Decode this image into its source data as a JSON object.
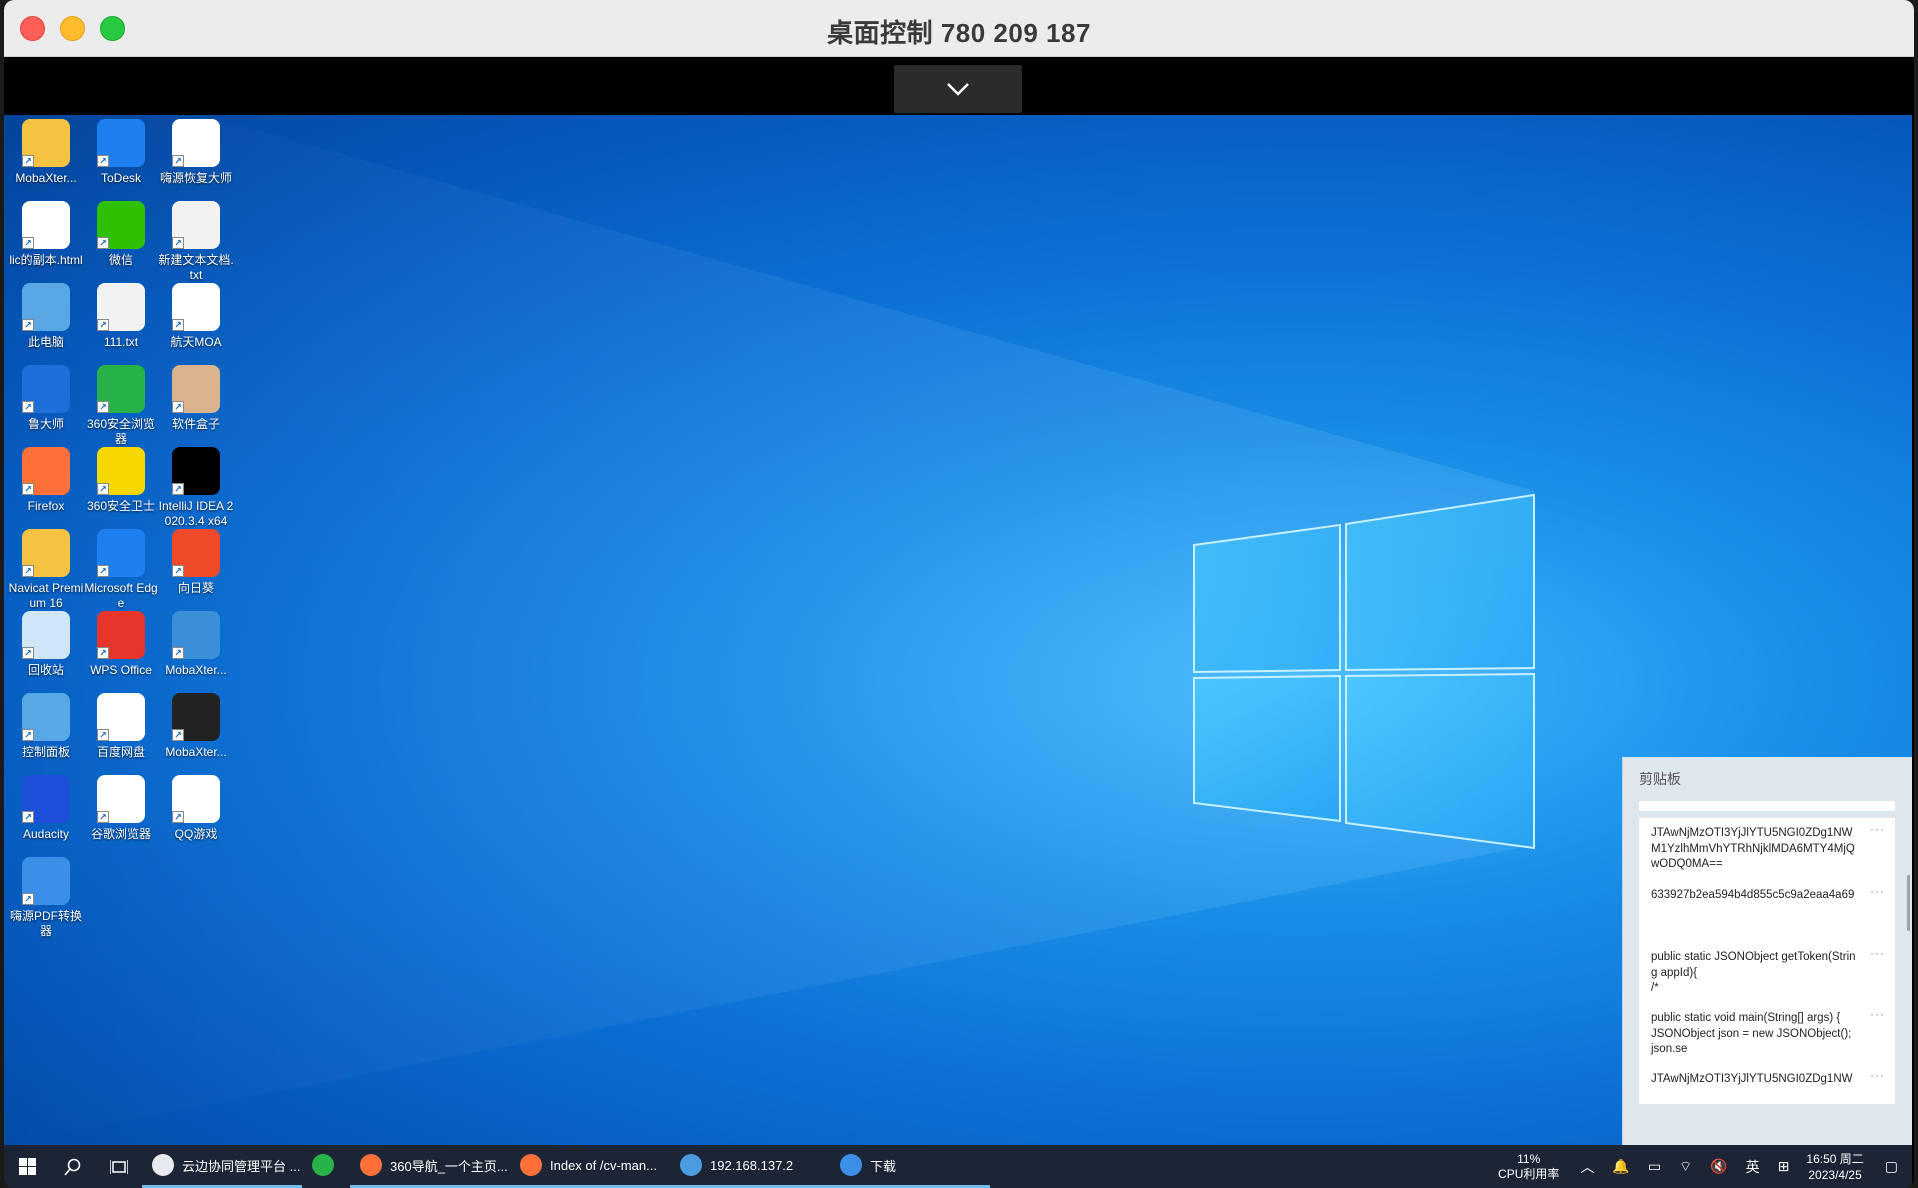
{
  "window": {
    "title": "桌面控制 780 209 187"
  },
  "desktop_icons": [
    {
      "label": "MobaXter...",
      "icon": "folder-icon",
      "color": "#f5c242"
    },
    {
      "label": "ToDesk",
      "icon": "todesk-icon",
      "color": "#1e7ff0"
    },
    {
      "label": "嗨源恢复大师",
      "icon": "recovery-icon",
      "color": "#ffffff"
    },
    {
      "label": "lic的副本.html",
      "icon": "html-file-icon",
      "color": "#ffffff"
    },
    {
      "label": "微信",
      "icon": "wechat-icon",
      "color": "#2dc100"
    },
    {
      "label": "新建文本文档.txt",
      "icon": "text-file-icon",
      "color": "#f2f2f2"
    },
    {
      "label": "此电脑",
      "icon": "this-pc-icon",
      "color": "#5aa7e6"
    },
    {
      "label": "111.txt",
      "icon": "text-file-icon",
      "color": "#f2f2f2"
    },
    {
      "label": "航天MOA",
      "icon": "casic-moa-icon",
      "color": "#ffffff"
    },
    {
      "label": "鲁大师",
      "icon": "ludashi-icon",
      "color": "#1e6fd9"
    },
    {
      "label": "360安全浏览器",
      "icon": "360-browser-icon",
      "color": "#27b24a"
    },
    {
      "label": "软件盒子",
      "icon": "software-box-icon",
      "color": "#d9b38c"
    },
    {
      "label": "Firefox",
      "icon": "firefox-icon",
      "color": "#ff7139"
    },
    {
      "label": "360安全卫士",
      "icon": "360-guard-icon",
      "color": "#f5d800"
    },
    {
      "label": "IntelliJ IDEA 2020.3.4 x64",
      "icon": "intellij-icon",
      "color": "#000000"
    },
    {
      "label": "Navicat Premium 16",
      "icon": "navicat-icon",
      "color": "#f5c242"
    },
    {
      "label": "Microsoft Edge",
      "icon": "edge-icon",
      "color": "#1e7ff0"
    },
    {
      "label": "向日葵",
      "icon": "sunflower-icon",
      "color": "#f04a2a"
    },
    {
      "label": "回收站",
      "icon": "recycle-bin-icon",
      "color": "#cfe6f7"
    },
    {
      "label": "WPS Office",
      "icon": "wps-icon",
      "color": "#e8352c"
    },
    {
      "label": "MobaXter...",
      "icon": "zip-archive-icon",
      "color": "#3b8fd9"
    },
    {
      "label": "控制面板",
      "icon": "control-panel-icon",
      "color": "#5aa7e6"
    },
    {
      "label": "百度网盘",
      "icon": "baidu-netdisk-icon",
      "color": "#ffffff"
    },
    {
      "label": "MobaXter...",
      "icon": "mobaxterm-icon",
      "color": "#222222"
    },
    {
      "label": "Audacity",
      "icon": "audacity-icon",
      "color": "#1e4fd9"
    },
    {
      "label": "谷歌浏览器",
      "icon": "chrome-icon",
      "color": "#ffffff"
    },
    {
      "label": "QQ游戏",
      "icon": "qq-game-icon",
      "color": "#ffffff"
    },
    {
      "label": "嗨源PDF转换器",
      "icon": "pdf-converter-icon",
      "color": "#3b8fe8"
    }
  ],
  "clipboard": {
    "title": "剪贴板",
    "more": "···",
    "items": [
      "JTAwNjMzOTI3YjJlYTU5NGI0ZDg1NWM1YzlhMmVhYTRhNjklMDA6MTY4MjQwODQ0MA==",
      "633927b2ea594b4d855c5c9a2eaa4a69",
      "public static JSONObject getToken(String appId){\n/*",
      "public static void main(String[] args) {\nJSONObject json = new JSONObject();\njson.se",
      "JTAwNjMzOTI3YjJlYTU5NGI0ZDg1NW"
    ]
  },
  "taskbar": {
    "apps": [
      {
        "label": "云边协同管理平台 ...",
        "icon": "chrome-icon",
        "color": "#e8eaed",
        "active": true
      },
      {
        "label": "",
        "icon": "360-browser-icon",
        "color": "#27b24a",
        "active": false
      },
      {
        "label": "360导航_一个主页...",
        "icon": "firefox-icon",
        "color": "#ff7139",
        "active": true
      },
      {
        "label": "Index of /cv-man...",
        "icon": "firefox-icon",
        "color": "#ff7139",
        "active": true
      },
      {
        "label": "192.168.137.2",
        "icon": "remote-desktop-icon",
        "color": "#4a9be0",
        "active": true
      },
      {
        "label": "下载",
        "icon": "download-icon",
        "color": "#3b8fe8",
        "active": true
      }
    ],
    "cpu_percent": "11%",
    "cpu_label": "CPU利用率",
    "ime": "英",
    "time": "16:50 周二",
    "date": "2023/4/25"
  }
}
